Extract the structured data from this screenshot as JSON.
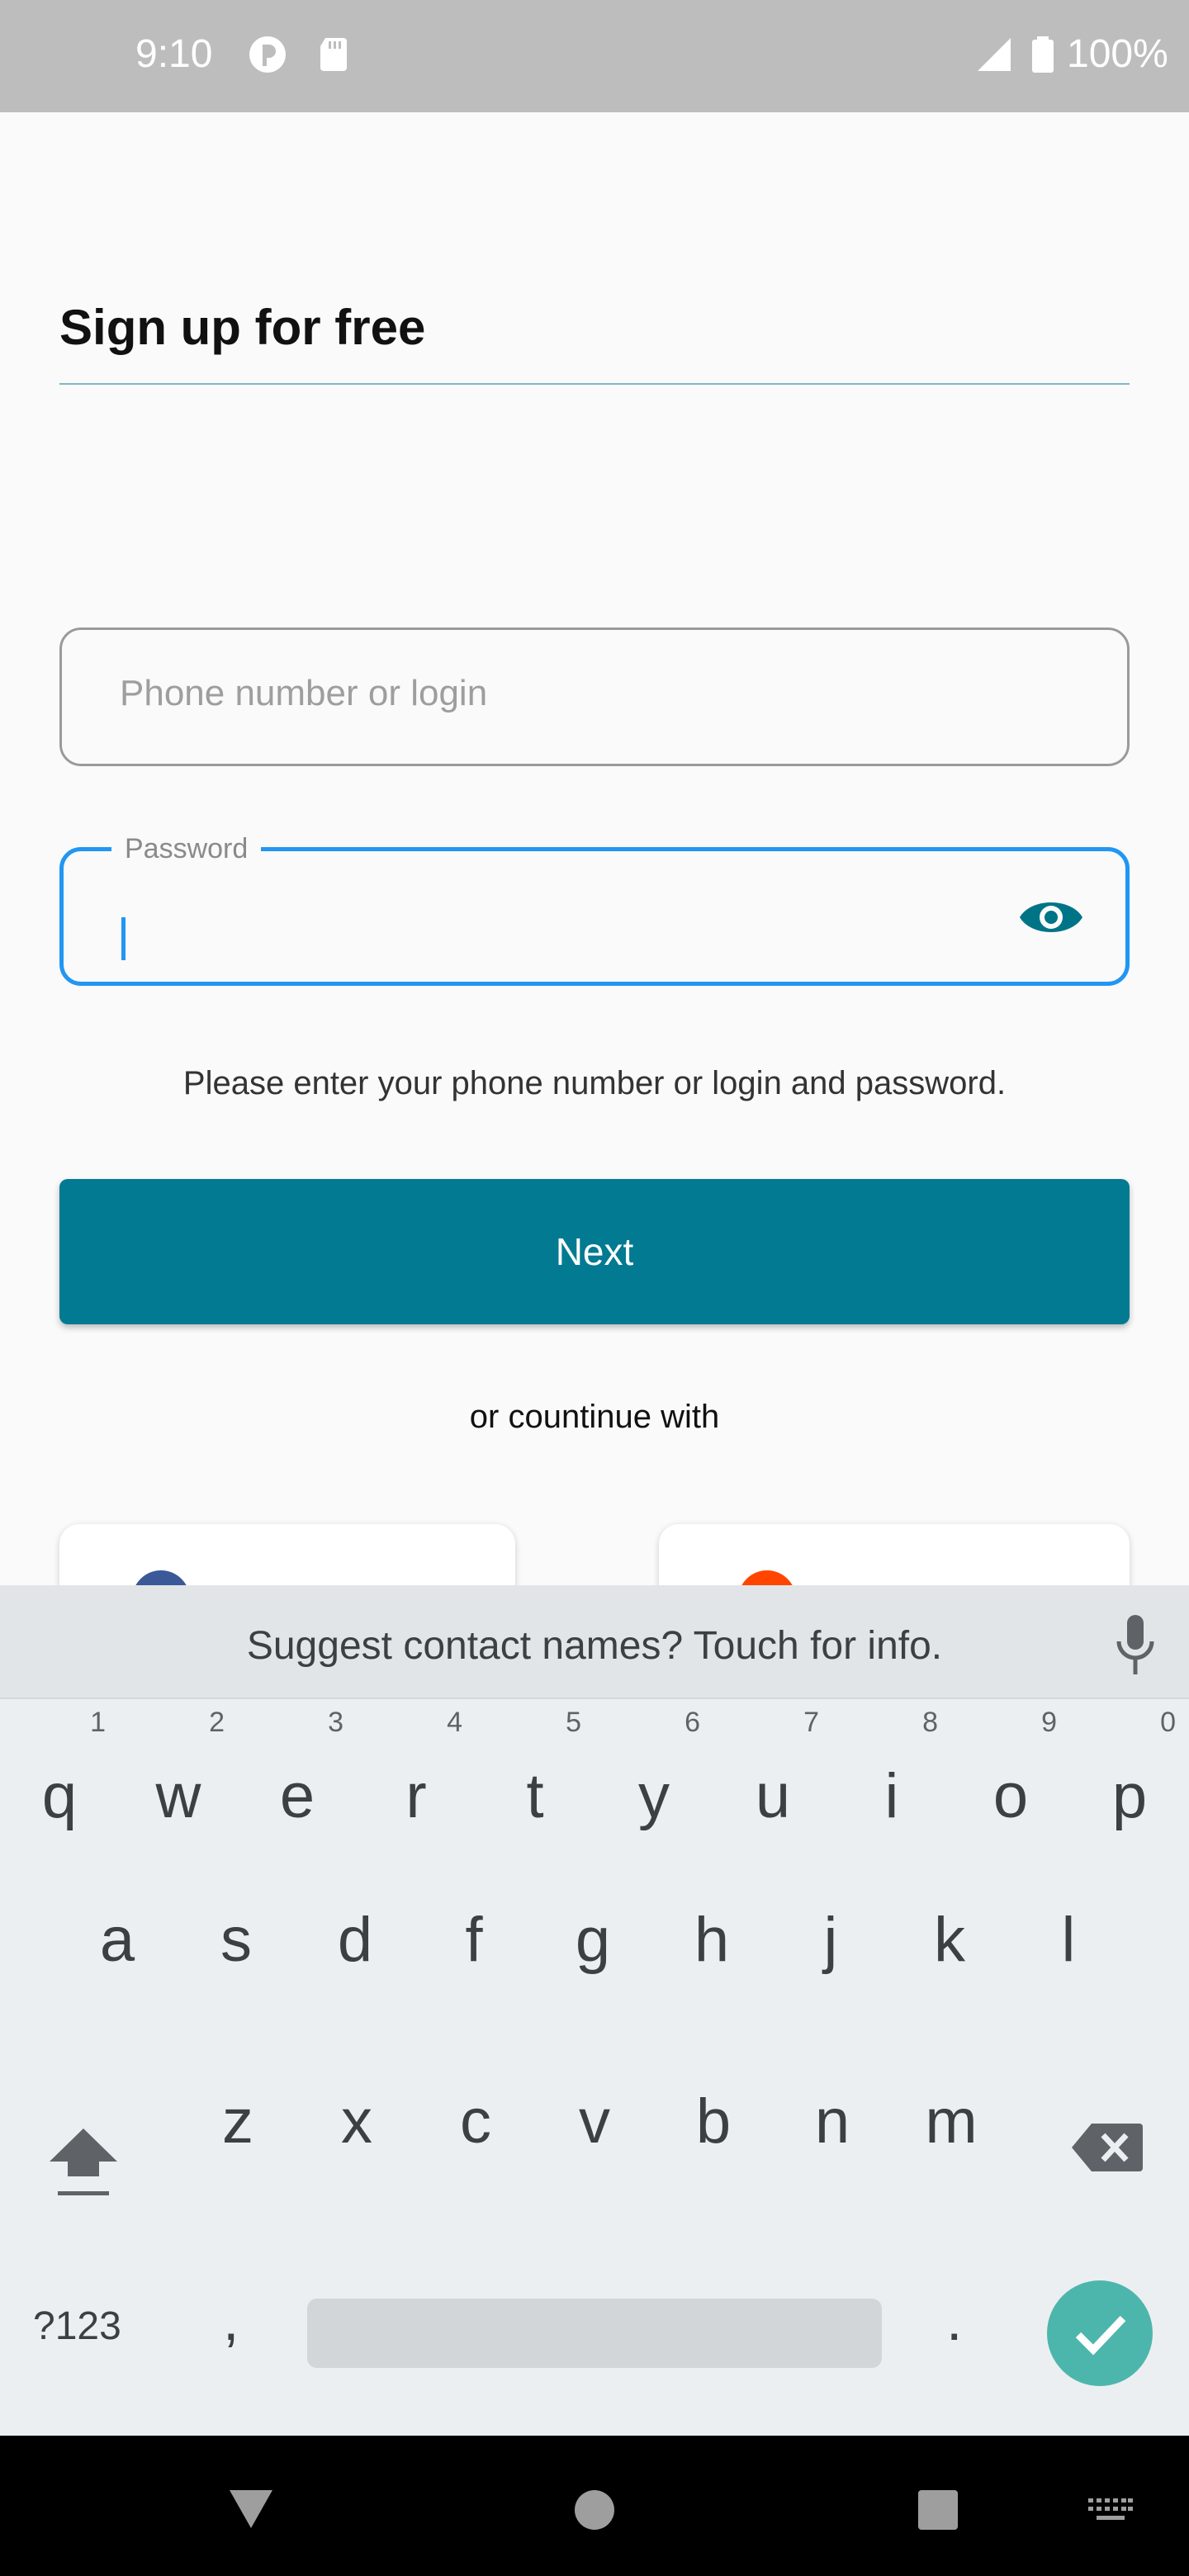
{
  "status_bar": {
    "time": "9:10",
    "battery": "100%",
    "icons": [
      "app-notification-icon",
      "sd-card-icon",
      "signal-icon",
      "battery-icon"
    ]
  },
  "form": {
    "title": "Sign up for free",
    "phone_placeholder": "Phone number or login",
    "password_label": "Password",
    "helper_text": "Please enter your phone number or login and password.",
    "next_label": "Next",
    "or_text": "or countinue with"
  },
  "keyboard": {
    "suggestion": "Suggest contact names? Touch for info.",
    "row1": [
      {
        "key": "q",
        "num": "1"
      },
      {
        "key": "w",
        "num": "2"
      },
      {
        "key": "e",
        "num": "3"
      },
      {
        "key": "r",
        "num": "4"
      },
      {
        "key": "t",
        "num": "5"
      },
      {
        "key": "y",
        "num": "6"
      },
      {
        "key": "u",
        "num": "7"
      },
      {
        "key": "i",
        "num": "8"
      },
      {
        "key": "o",
        "num": "9"
      },
      {
        "key": "p",
        "num": "0"
      }
    ],
    "row2": [
      "a",
      "s",
      "d",
      "f",
      "g",
      "h",
      "j",
      "k",
      "l"
    ],
    "row3": [
      "z",
      "x",
      "c",
      "v",
      "b",
      "n",
      "m"
    ],
    "symbols_label": "?123",
    "comma": ",",
    "period": "."
  },
  "colors": {
    "accent": "#027a91",
    "focus": "#2196f3",
    "enter": "#4db6ac"
  }
}
